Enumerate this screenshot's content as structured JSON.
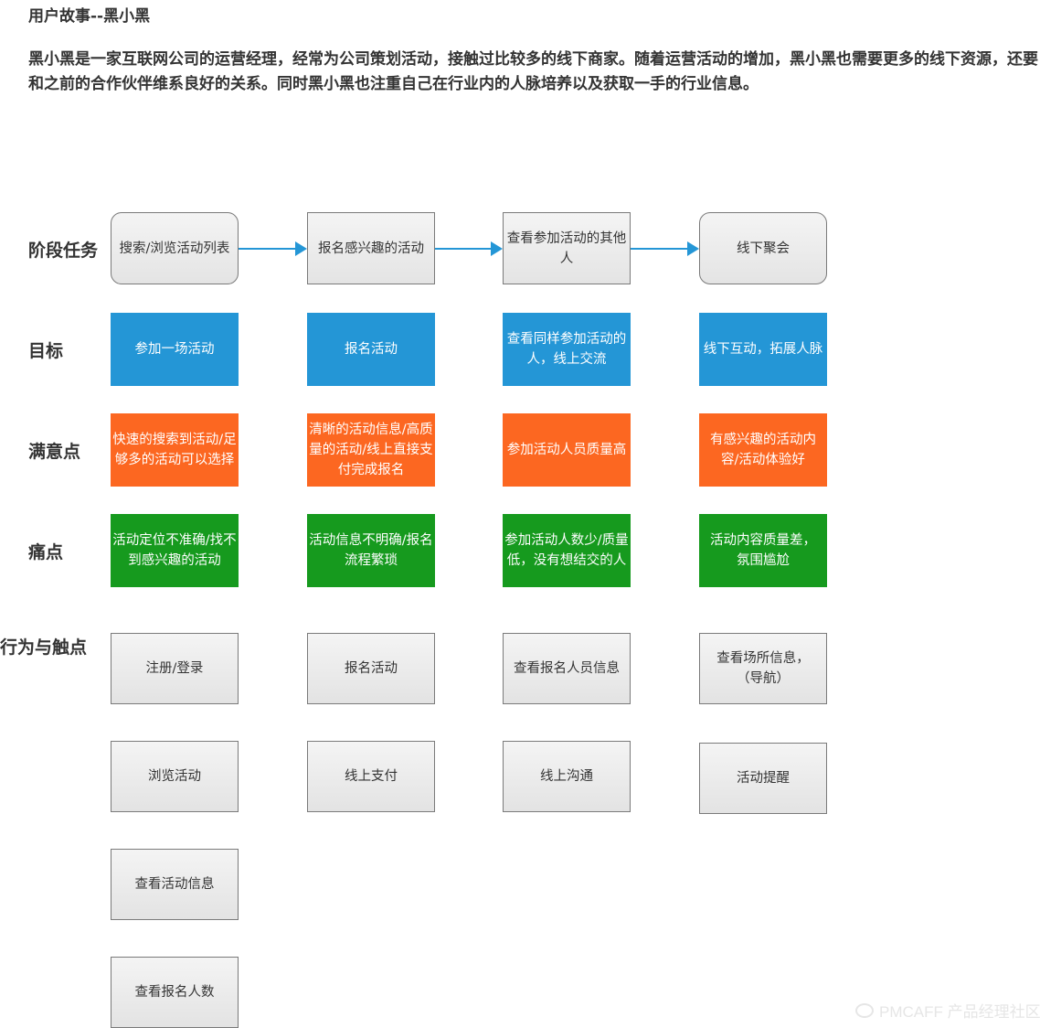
{
  "header": {
    "title": "用户故事--黑小黑",
    "description": "黑小黑是一家互联网公司的运营经理，经常为公司策划活动，接触过比较多的线下商家。随着运营活动的增加，黑小黑也需要更多的线下资源，还要和之前的合作伙伴维系良好的关系。同时黑小黑也注重自己在行业内的人脉培养以及获取一手的行业信息。"
  },
  "rows": {
    "stage": {
      "label": "阶段任务",
      "items": [
        "搜索/浏览活动列表",
        "报名感兴趣的活动",
        "查看参加活动的其他人",
        "线下聚会"
      ]
    },
    "goal": {
      "label": "目标",
      "items": [
        "参加一场活动",
        "报名活动",
        "查看同样参加活动的人，线上交流",
        "线下互动，拓展人脉"
      ]
    },
    "satisfaction": {
      "label": "满意点",
      "items": [
        "快速的搜索到活动/足够多的活动可以选择",
        "清晰的活动信息/高质量的活动/线上直接支付完成报名",
        "参加活动人员质量高",
        "有感兴趣的活动内容/活动体验好"
      ]
    },
    "pain": {
      "label": "痛点",
      "items": [
        "活动定位不准确/找不到感兴趣的活动",
        "活动信息不明确/报名流程繁琐",
        "参加活动人数少/质量低，没有想结交的人",
        "活动内容质量差，氛围尴尬"
      ]
    },
    "touchpoints": {
      "label": "行为与触点",
      "columns": [
        [
          "注册/登录",
          "浏览活动",
          "查看活动信息",
          "查看报名人数"
        ],
        [
          "报名活动",
          "线上支付"
        ],
        [
          "查看报名人员信息",
          "线上沟通"
        ],
        [
          "查看场所信息，（导航）",
          "活动提醒"
        ]
      ]
    }
  },
  "colors": {
    "goal": "#2496d6",
    "satisfaction": "#fc6721",
    "pain": "#169a1e",
    "arrow": "#2496d6"
  },
  "watermark": {
    "text": "PMCAFF 产品经理社区",
    "icon": "pmcaff-logo-icon"
  }
}
